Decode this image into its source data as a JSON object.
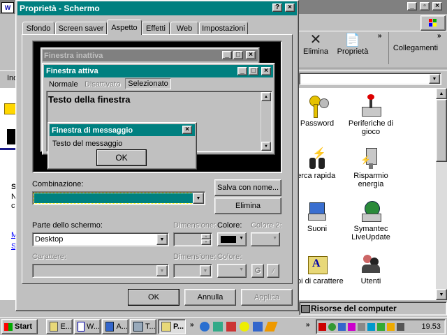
{
  "dialog": {
    "title": "Proprietà - Schermo",
    "tabs": [
      "Sfondo",
      "Screen saver",
      "Aspetto",
      "Effetti",
      "Web",
      "Impostazioni"
    ],
    "active_tab": "Aspetto",
    "preview": {
      "inactive_title": "Finestra inattiva",
      "active_title": "Finestra attiva",
      "menu_normal": "Normale",
      "menu_disabled": "Disattivato",
      "menu_selected": "Selezionato",
      "window_text": "Testo della finestra",
      "msgbox_title": "Finestra di messaggio",
      "msgbox_text": "Testo del messaggio",
      "msgbox_ok": "OK"
    },
    "scheme_label": "Combinazione:",
    "save_as_label": "Salva con nome...",
    "delete_label": "Elimina",
    "item_label": "Parte dello schermo:",
    "item_value": "Desktop",
    "size_label": "Dimensione:",
    "color_label": "Colore:",
    "color2_label": "Colore 2:",
    "font_label": "Carattere:",
    "font_size_label": "Dimensione:",
    "font_color_label": "Colore:",
    "bold_label": "G",
    "ok_label": "OK",
    "cancel_label": "Annulla",
    "apply_label": "Applica"
  },
  "explorer": {
    "toolbar_delete": "Elimina",
    "toolbar_properties": "Proprietà",
    "toolbar_links": "Collegamenti",
    "address_prefix": "Ind",
    "status": "Risorse del computer",
    "icons": [
      {
        "label": "Password",
        "icon": "password-keys-icon"
      },
      {
        "label": "Periferiche di gioco",
        "icon": "joystick-icon"
      },
      {
        "label": "cerca rapida",
        "icon": "binoculars-icon"
      },
      {
        "label": "Risparmio energia",
        "icon": "power-plug-icon"
      },
      {
        "label": "Suoni",
        "icon": "speaker-icon"
      },
      {
        "label": "Symantec LiveUpdate",
        "icon": "globe-computer-icon"
      },
      {
        "label": "Tipi di carattere",
        "icon": "fonts-folder-icon"
      },
      {
        "label": "Utenti",
        "icon": "users-icon"
      }
    ]
  },
  "taskbar": {
    "start_label": "Start",
    "tasks": [
      "E...",
      "W...",
      "A...",
      "T...",
      "P..."
    ],
    "clock": "19.53"
  },
  "colors": {
    "title_active": "#008080",
    "desktop": "#008080",
    "selection": "#008080"
  }
}
